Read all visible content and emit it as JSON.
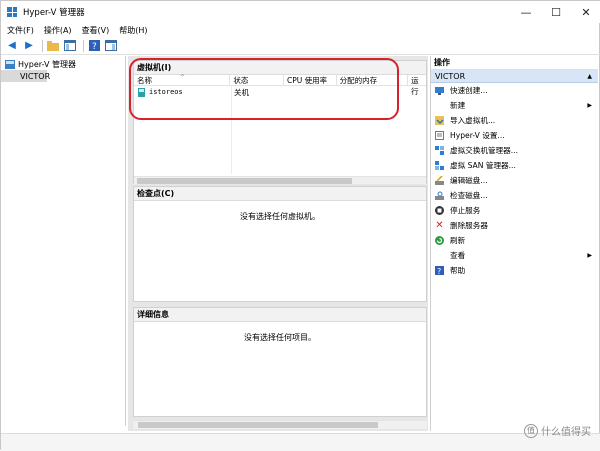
{
  "window": {
    "title": "Hyper-V 管理器",
    "minimize": "—",
    "maximize": "☐",
    "close": "✕"
  },
  "menu": [
    "文件(F)",
    "操作(A)",
    "查看(V)",
    "帮助(H)"
  ],
  "tree": {
    "root": "Hyper-V 管理器",
    "server": "VICTOR"
  },
  "vm_panel": {
    "title": "虚拟机(I)",
    "columns": [
      "名称",
      "状态",
      "CPU 使用率",
      "分配的内存",
      "运行"
    ],
    "rows": [
      {
        "name": "istoreos",
        "state": "关机",
        "cpu": "",
        "memory": "",
        "uptime": ""
      }
    ]
  },
  "checkpoint_panel": {
    "title": "检查点(C)",
    "empty": "没有选择任何虚拟机。"
  },
  "details_panel": {
    "title": "详细信息",
    "empty": "没有选择任何项目。"
  },
  "actions": {
    "title": "操作",
    "section": "VICTOR",
    "items": [
      {
        "label": "快速创建...",
        "icon": "quick-create-icon"
      },
      {
        "label": "新建",
        "icon": "none",
        "submenu": true
      },
      {
        "label": "导入虚拟机...",
        "icon": "import-vm-icon"
      },
      {
        "label": "Hyper-V 设置...",
        "icon": "settings-icon"
      },
      {
        "label": "虚拟交换机管理器...",
        "icon": "switch-manager-icon"
      },
      {
        "label": "虚拟 SAN 管理器...",
        "icon": "san-manager-icon"
      },
      {
        "label": "编辑磁盘...",
        "icon": "edit-disk-icon"
      },
      {
        "label": "检查磁盘...",
        "icon": "inspect-disk-icon"
      },
      {
        "label": "停止服务",
        "icon": "stop-service-icon"
      },
      {
        "label": "删除服务器",
        "icon": "remove-server-icon"
      },
      {
        "label": "刷新",
        "icon": "refresh-icon"
      },
      {
        "label": "查看",
        "icon": "none",
        "submenu": true
      },
      {
        "label": "帮助",
        "icon": "help-icon"
      }
    ]
  },
  "watermark": {
    "glyph": "值",
    "text": "什么值得买"
  }
}
